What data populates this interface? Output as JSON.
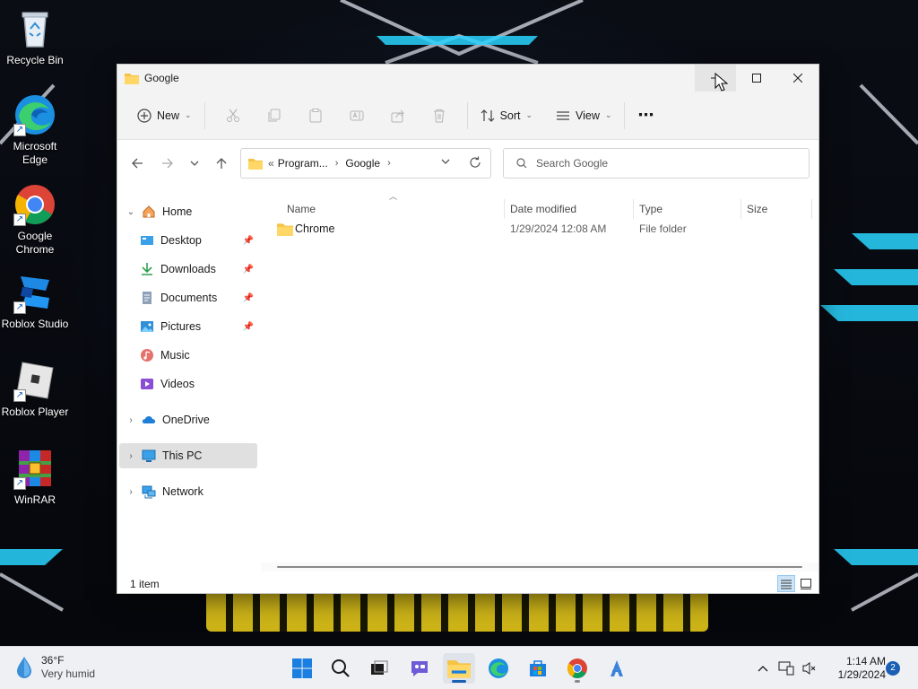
{
  "desktop": {
    "icons": [
      {
        "label": "Recycle Bin"
      },
      {
        "label": "Microsoft Edge"
      },
      {
        "label": "Google Chrome"
      },
      {
        "label": "Roblox Studio"
      },
      {
        "label": "Roblox Player"
      },
      {
        "label": "WinRAR"
      }
    ]
  },
  "window": {
    "title": "Google",
    "controls": {
      "minimize": "minimize-icon",
      "maximize": "maximize-icon",
      "close": "close-icon"
    }
  },
  "commandbar": {
    "new_label": "New",
    "sort_label": "Sort",
    "view_label": "View",
    "more_label": "⋯"
  },
  "address": {
    "overflow": "«",
    "crumbs": [
      "Program...",
      "Google"
    ]
  },
  "search": {
    "placeholder": "Search Google"
  },
  "navpane": {
    "home": "Home",
    "quick_access": [
      {
        "label": "Desktop"
      },
      {
        "label": "Downloads"
      },
      {
        "label": "Documents"
      },
      {
        "label": "Pictures"
      },
      {
        "label": "Music"
      },
      {
        "label": "Videos"
      }
    ],
    "onedrive": "OneDrive",
    "this_pc": "This PC",
    "network": "Network"
  },
  "content": {
    "columns": {
      "name": "Name",
      "date": "Date modified",
      "type": "Type",
      "size": "Size"
    },
    "rows": [
      {
        "name": "Chrome",
        "date": "1/29/2024 12:08 AM",
        "type": "File folder",
        "size": ""
      }
    ]
  },
  "status": {
    "count": "1 item"
  },
  "taskbar": {
    "weather": {
      "temp": "36°F",
      "condition": "Very humid"
    },
    "clock": {
      "time": "1:14 AM",
      "date": "1/29/2024"
    },
    "notifications": "2"
  },
  "colors": {
    "accent": "#1a5fb4",
    "folder": "#f5c242",
    "selection": "#e0e0e0"
  }
}
